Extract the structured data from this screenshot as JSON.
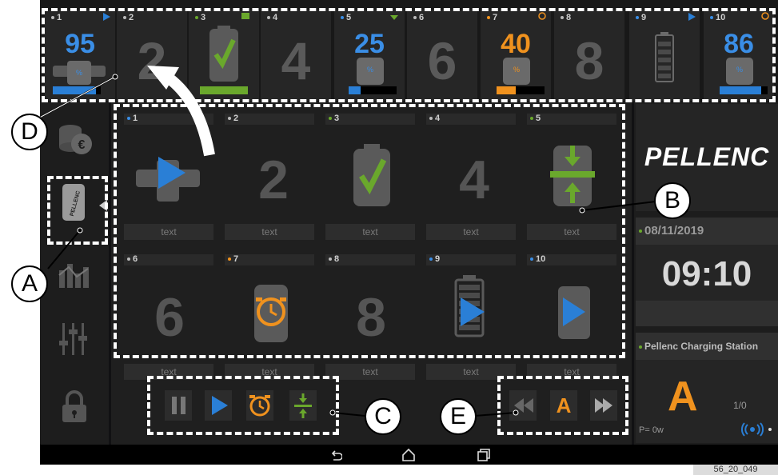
{
  "top_slots": [
    {
      "num": "1",
      "value": "95",
      "value_color": "#3a8ee6",
      "bar_fill": 0.9,
      "bar_color": "#2a7fd6"
    },
    {
      "num": "2",
      "value": "2"
    },
    {
      "num": "3",
      "bar_fill": 1.0,
      "bar_color": "#6aa82c"
    },
    {
      "num": "4",
      "value": "4"
    },
    {
      "num": "5",
      "value": "25",
      "value_color": "#3a8ee6",
      "bar_fill": 0.25,
      "bar_color": "#2a7fd6"
    },
    {
      "num": "6",
      "value": "6"
    },
    {
      "num": "7",
      "value": "40",
      "value_color": "#f0921e",
      "bar_fill": 0.4,
      "bar_color": "#f0921e"
    },
    {
      "num": "8",
      "value": "8"
    },
    {
      "num": "9"
    },
    {
      "num": "10",
      "value": "86",
      "value_color": "#3a8ee6",
      "bar_fill": 0.86,
      "bar_color": "#2a7fd6"
    }
  ],
  "grid_cells": [
    {
      "num": "1",
      "label": "text"
    },
    {
      "num": "2",
      "label": "text",
      "big": "2"
    },
    {
      "num": "3",
      "label": "text"
    },
    {
      "num": "4",
      "label": "text",
      "big": "4"
    },
    {
      "num": "5",
      "label": "text"
    },
    {
      "num": "6",
      "label": "text",
      "big": "6"
    },
    {
      "num": "7",
      "label": "text"
    },
    {
      "num": "8",
      "label": "text",
      "big": "8"
    },
    {
      "num": "9",
      "label": "text"
    },
    {
      "num": "10",
      "label": "text"
    }
  ],
  "slot7_percent": "%",
  "slot5_percent": "%",
  "slot1_percent": "%",
  "slot10_percent": "%",
  "brand": "PELLENC",
  "date": "08/11/2019",
  "time": "09:10",
  "station": {
    "title": "Pellenc Charging Station",
    "mode": "A",
    "ratio": "1/0",
    "power": "P= 0w"
  },
  "callouts": {
    "a": "A",
    "b": "B",
    "c": "C",
    "d": "D",
    "e": "E"
  },
  "ctrl_mode": "A",
  "footer_code": "56_20_049",
  "colors": {
    "accent_blue": "#2a7fd6",
    "accent_green": "#6aa82c",
    "accent_orange": "#f0921e"
  }
}
